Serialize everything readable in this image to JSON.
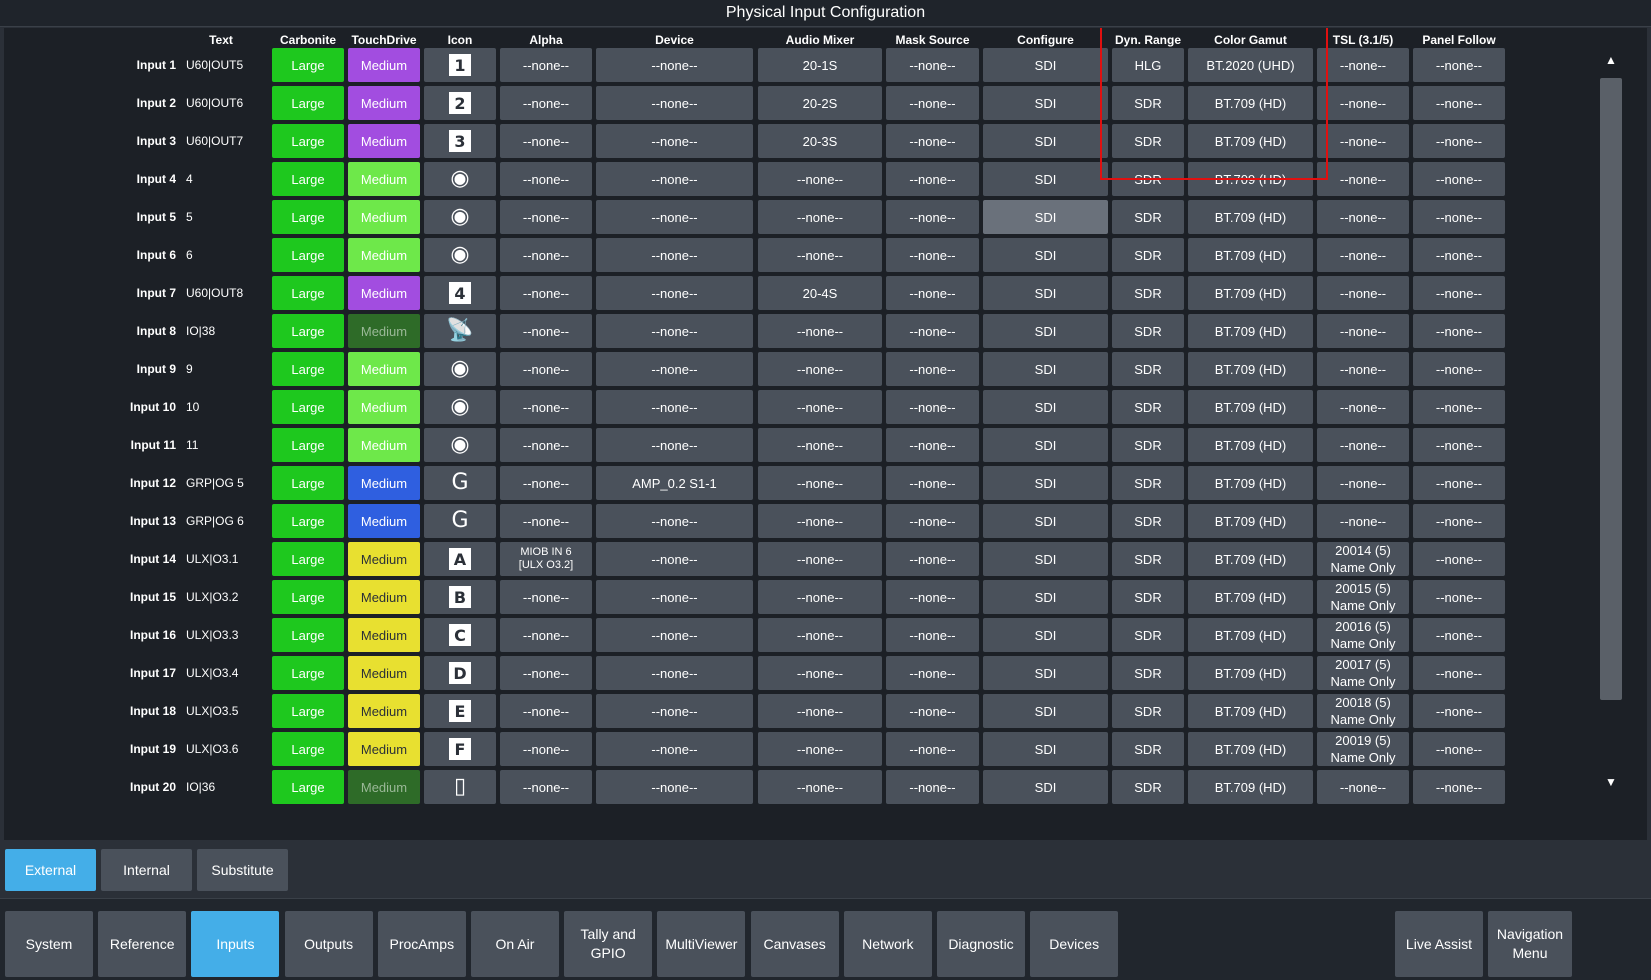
{
  "title": "Physical Input Configuration",
  "columns": {
    "text": "Text",
    "carbonite": "Carbonite",
    "touchdrive": "TouchDrive",
    "icon": "Icon",
    "alpha": "Alpha",
    "device": "Device",
    "audio_mixer": "Audio Mixer",
    "mask_source": "Mask Source",
    "configure": "Configure",
    "dyn_range": "Dyn. Range",
    "color_gamut": "Color Gamut",
    "tsl": "TSL (3.1/5)",
    "panel_follow": "Panel Follow"
  },
  "rows": [
    {
      "label": "Input 1",
      "text": "U60|OUT5",
      "carbonite": "Large",
      "touchdrive": "Medium",
      "touchdrive_color": "#a24de0",
      "icon": "1",
      "icon_type": "box",
      "alpha": "--none--",
      "device": "--none--",
      "audio": "20-1S",
      "mask": "--none--",
      "configure": "SDI",
      "dyn": "HLG",
      "gamut": "BT.2020 (UHD)",
      "tsl": "--none--",
      "panel": "--none--"
    },
    {
      "label": "Input 2",
      "text": "U60|OUT6",
      "carbonite": "Large",
      "touchdrive": "Medium",
      "touchdrive_color": "#a24de0",
      "icon": "2",
      "icon_type": "box",
      "alpha": "--none--",
      "device": "--none--",
      "audio": "20-2S",
      "mask": "--none--",
      "configure": "SDI",
      "dyn": "SDR",
      "gamut": "BT.709 (HD)",
      "tsl": "--none--",
      "panel": "--none--"
    },
    {
      "label": "Input 3",
      "text": "U60|OUT7",
      "carbonite": "Large",
      "touchdrive": "Medium",
      "touchdrive_color": "#a24de0",
      "icon": "3",
      "icon_type": "box",
      "alpha": "--none--",
      "device": "--none--",
      "audio": "20-3S",
      "mask": "--none--",
      "configure": "SDI",
      "dyn": "SDR",
      "gamut": "BT.709 (HD)",
      "tsl": "--none--",
      "panel": "--none--"
    },
    {
      "label": "Input 4",
      "text": "4",
      "carbonite": "Large",
      "touchdrive": "Medium",
      "touchdrive_color": "#6ee84a",
      "icon": "◉",
      "icon_type": "glyph",
      "icon_name": "camera-icon",
      "alpha": "--none--",
      "device": "--none--",
      "audio": "--none--",
      "mask": "--none--",
      "configure": "SDI",
      "dyn": "SDR",
      "gamut": "BT.709 (HD)",
      "tsl": "--none--",
      "panel": "--none--"
    },
    {
      "label": "Input 5",
      "text": "5",
      "carbonite": "Large",
      "touchdrive": "Medium",
      "touchdrive_color": "#6ee84a",
      "icon": "◉",
      "icon_type": "glyph",
      "icon_name": "camera-icon",
      "alpha": "--none--",
      "device": "--none--",
      "audio": "--none--",
      "mask": "--none--",
      "configure": "SDI",
      "configure_selected": true,
      "dyn": "SDR",
      "gamut": "BT.709 (HD)",
      "tsl": "--none--",
      "panel": "--none--"
    },
    {
      "label": "Input 6",
      "text": "6",
      "carbonite": "Large",
      "touchdrive": "Medium",
      "touchdrive_color": "#6ee84a",
      "icon": "◉",
      "icon_type": "glyph",
      "icon_name": "camera-icon",
      "alpha": "--none--",
      "device": "--none--",
      "audio": "--none--",
      "mask": "--none--",
      "configure": "SDI",
      "dyn": "SDR",
      "gamut": "BT.709 (HD)",
      "tsl": "--none--",
      "panel": "--none--"
    },
    {
      "label": "Input 7",
      "text": "U60|OUT8",
      "carbonite": "Large",
      "touchdrive": "Medium",
      "touchdrive_color": "#a24de0",
      "icon": "4",
      "icon_type": "box",
      "alpha": "--none--",
      "device": "--none--",
      "audio": "20-4S",
      "mask": "--none--",
      "configure": "SDI",
      "dyn": "SDR",
      "gamut": "BT.709 (HD)",
      "tsl": "--none--",
      "panel": "--none--"
    },
    {
      "label": "Input 8",
      "text": "IO|38",
      "carbonite": "Large",
      "touchdrive": "Medium",
      "touchdrive_color": "#2e6b28",
      "touchdrive_dim": true,
      "icon": "📡",
      "icon_type": "glyph",
      "icon_name": "satellite-dish-icon",
      "alpha": "--none--",
      "device": "--none--",
      "audio": "--none--",
      "mask": "--none--",
      "configure": "SDI",
      "dyn": "SDR",
      "gamut": "BT.709 (HD)",
      "tsl": "--none--",
      "panel": "--none--"
    },
    {
      "label": "Input 9",
      "text": "9",
      "carbonite": "Large",
      "touchdrive": "Medium",
      "touchdrive_color": "#6ee84a",
      "icon": "◉",
      "icon_type": "glyph",
      "icon_name": "camera-icon",
      "alpha": "--none--",
      "device": "--none--",
      "audio": "--none--",
      "mask": "--none--",
      "configure": "SDI",
      "dyn": "SDR",
      "gamut": "BT.709 (HD)",
      "tsl": "--none--",
      "panel": "--none--"
    },
    {
      "label": "Input 10",
      "text": "10",
      "carbonite": "Large",
      "touchdrive": "Medium",
      "touchdrive_color": "#6ee84a",
      "icon": "◉",
      "icon_type": "glyph",
      "icon_name": "camera-icon",
      "alpha": "--none--",
      "device": "--none--",
      "audio": "--none--",
      "mask": "--none--",
      "configure": "SDI",
      "dyn": "SDR",
      "gamut": "BT.709 (HD)",
      "tsl": "--none--",
      "panel": "--none--"
    },
    {
      "label": "Input 11",
      "text": "11",
      "carbonite": "Large",
      "touchdrive": "Medium",
      "touchdrive_color": "#6ee84a",
      "icon": "◉",
      "icon_type": "glyph",
      "icon_name": "camera-icon",
      "alpha": "--none--",
      "device": "--none--",
      "audio": "--none--",
      "mask": "--none--",
      "configure": "SDI",
      "dyn": "SDR",
      "gamut": "BT.709 (HD)",
      "tsl": "--none--",
      "panel": "--none--"
    },
    {
      "label": "Input 12",
      "text": "GRP|OG 5",
      "carbonite": "Large",
      "touchdrive": "Medium",
      "touchdrive_color": "#2f5fe0",
      "icon": "G",
      "icon_type": "glyph",
      "icon_name": "graphics-icon",
      "alpha": "--none--",
      "device": "AMP_0.2 S1-1",
      "audio": "--none--",
      "mask": "--none--",
      "configure": "SDI",
      "dyn": "SDR",
      "gamut": "BT.709 (HD)",
      "tsl": "--none--",
      "panel": "--none--"
    },
    {
      "label": "Input 13",
      "text": "GRP|OG 6",
      "carbonite": "Large",
      "touchdrive": "Medium",
      "touchdrive_color": "#2f5fe0",
      "icon": "G",
      "icon_type": "glyph",
      "icon_name": "graphics-icon",
      "alpha": "--none--",
      "device": "--none--",
      "audio": "--none--",
      "mask": "--none--",
      "configure": "SDI",
      "dyn": "SDR",
      "gamut": "BT.709 (HD)",
      "tsl": "--none--",
      "panel": "--none--"
    },
    {
      "label": "Input 14",
      "text": "ULX|O3.1",
      "carbonite": "Large",
      "touchdrive": "Medium",
      "touchdrive_color": "#e8e030",
      "touchdrive_text_color": "#2b3038",
      "icon": "A",
      "icon_type": "box",
      "alpha": "MIOB IN 6\n[ULX O3.2]",
      "alpha_small": true,
      "device": "--none--",
      "audio": "--none--",
      "mask": "--none--",
      "configure": "SDI",
      "dyn": "SDR",
      "gamut": "BT.709 (HD)",
      "tsl": "20014 (5)\nName Only",
      "panel": "--none--"
    },
    {
      "label": "Input 15",
      "text": "ULX|O3.2",
      "carbonite": "Large",
      "touchdrive": "Medium",
      "touchdrive_color": "#e8e030",
      "touchdrive_text_color": "#2b3038",
      "icon": "B",
      "icon_type": "box",
      "alpha": "--none--",
      "device": "--none--",
      "audio": "--none--",
      "mask": "--none--",
      "configure": "SDI",
      "dyn": "SDR",
      "gamut": "BT.709 (HD)",
      "tsl": "20015 (5)\nName Only",
      "panel": "--none--"
    },
    {
      "label": "Input 16",
      "text": "ULX|O3.3",
      "carbonite": "Large",
      "touchdrive": "Medium",
      "touchdrive_color": "#e8e030",
      "touchdrive_text_color": "#2b3038",
      "icon": "C",
      "icon_type": "box",
      "alpha": "--none--",
      "device": "--none--",
      "audio": "--none--",
      "mask": "--none--",
      "configure": "SDI",
      "dyn": "SDR",
      "gamut": "BT.709 (HD)",
      "tsl": "20016 (5)\nName Only",
      "panel": "--none--"
    },
    {
      "label": "Input 17",
      "text": "ULX|O3.4",
      "carbonite": "Large",
      "touchdrive": "Medium",
      "touchdrive_color": "#e8e030",
      "touchdrive_text_color": "#2b3038",
      "icon": "D",
      "icon_type": "box",
      "alpha": "--none--",
      "device": "--none--",
      "audio": "--none--",
      "mask": "--none--",
      "configure": "SDI",
      "dyn": "SDR",
      "gamut": "BT.709 (HD)",
      "tsl": "20017 (5)\nName Only",
      "panel": "--none--"
    },
    {
      "label": "Input 18",
      "text": "ULX|O3.5",
      "carbonite": "Large",
      "touchdrive": "Medium",
      "touchdrive_color": "#e8e030",
      "touchdrive_text_color": "#2b3038",
      "icon": "E",
      "icon_type": "box",
      "alpha": "--none--",
      "device": "--none--",
      "audio": "--none--",
      "mask": "--none--",
      "configure": "SDI",
      "dyn": "SDR",
      "gamut": "BT.709 (HD)",
      "tsl": "20018 (5)\nName Only",
      "panel": "--none--"
    },
    {
      "label": "Input 19",
      "text": "ULX|O3.6",
      "carbonite": "Large",
      "touchdrive": "Medium",
      "touchdrive_color": "#e8e030",
      "touchdrive_text_color": "#2b3038",
      "icon": "F",
      "icon_type": "box",
      "alpha": "--none--",
      "device": "--none--",
      "audio": "--none--",
      "mask": "--none--",
      "configure": "SDI",
      "dyn": "SDR",
      "gamut": "BT.709 (HD)",
      "tsl": "20019 (5)\nName Only",
      "panel": "--none--"
    },
    {
      "label": "Input 20",
      "text": "IO|36",
      "carbonite": "Large",
      "touchdrive": "Medium",
      "touchdrive_color": "#2e6b28",
      "touchdrive_dim": true,
      "icon": "▯",
      "icon_type": "glyph",
      "icon_name": "device-icon",
      "alpha": "--none--",
      "device": "--none--",
      "audio": "--none--",
      "mask": "--none--",
      "configure": "SDI",
      "dyn": "SDR",
      "gamut": "BT.709 (HD)",
      "tsl": "--none--",
      "panel": "--none--"
    }
  ],
  "subtabs": [
    {
      "label": "External",
      "active": true
    },
    {
      "label": "Internal",
      "active": false
    },
    {
      "label": "Substitute",
      "active": false
    }
  ],
  "nav": [
    {
      "label": "System",
      "active": false
    },
    {
      "label": "Reference",
      "active": false
    },
    {
      "label": "Inputs",
      "active": true
    },
    {
      "label": "Outputs",
      "active": false
    },
    {
      "label": "ProcAmps",
      "active": false
    },
    {
      "label": "On Air",
      "active": false
    },
    {
      "label": "Tally and GPIO",
      "active": false
    },
    {
      "label": "MultiViewer",
      "active": false
    },
    {
      "label": "Canvases",
      "active": false
    },
    {
      "label": "Network",
      "active": false
    },
    {
      "label": "Diagnostic",
      "active": false
    },
    {
      "label": "Devices",
      "active": false
    }
  ],
  "nav_right": [
    {
      "label": "Live Assist"
    },
    {
      "label": "Navigation Menu"
    }
  ],
  "colors": {
    "large_green": "#1ec81e",
    "active_blue": "#44aee8",
    "cell_gray": "#4a515b",
    "highlight_red": "#e01010"
  },
  "scroll": {
    "up_icon": "▲",
    "down_icon": "▼"
  }
}
